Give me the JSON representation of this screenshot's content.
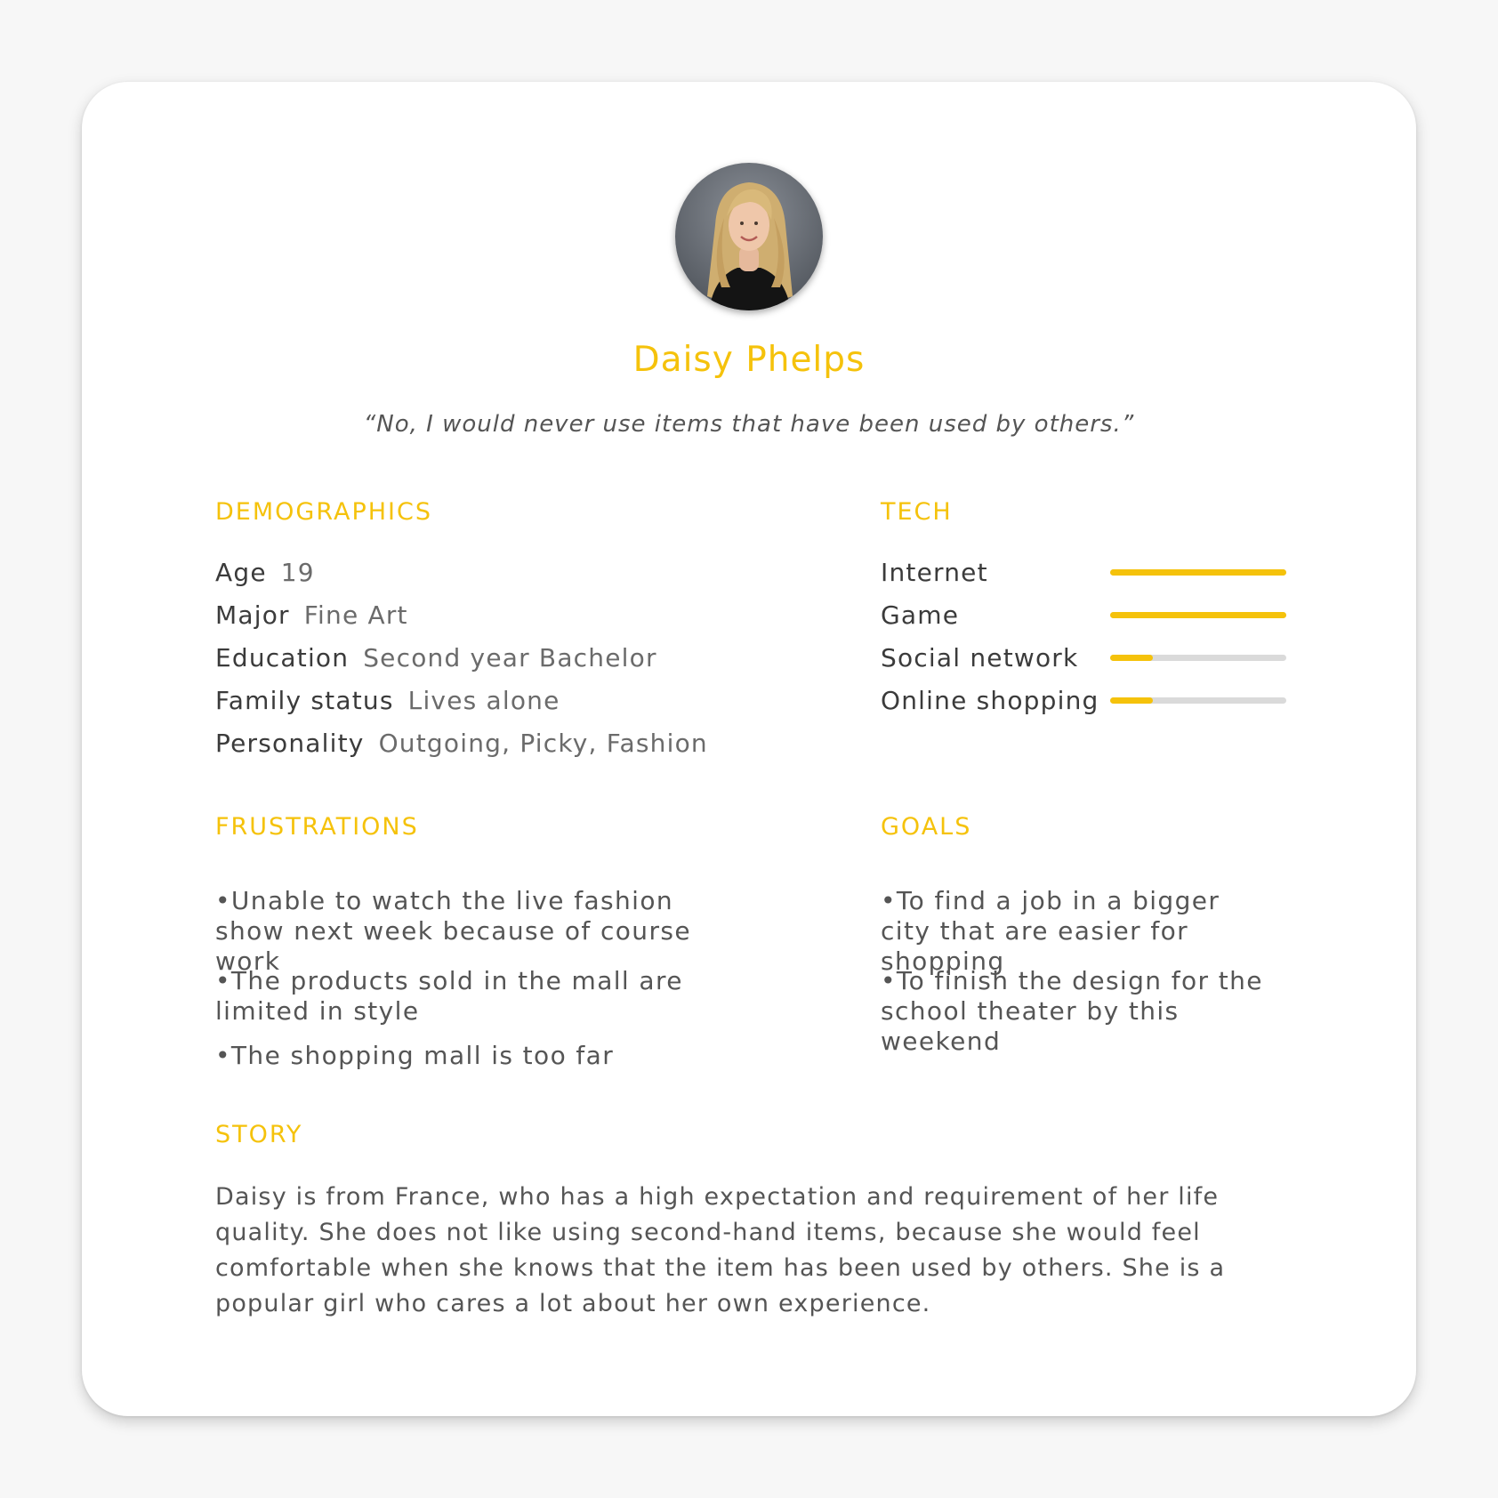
{
  "persona": {
    "name": "Daisy Phelps",
    "quote": "“No, I would never use items that have been used by others.”"
  },
  "demographics": {
    "title": "DEMOGRAPHICS",
    "rows": [
      {
        "key": "Age",
        "value": "19"
      },
      {
        "key": "Major",
        "value": "Fine Art"
      },
      {
        "key": "Education",
        "value": "Second year Bachelor"
      },
      {
        "key": "Family status",
        "value": "Lives alone"
      },
      {
        "key": "Personality",
        "value": "Outgoing, Picky, Fashion"
      }
    ]
  },
  "tech": {
    "title": "TECH",
    "accent_color": "#f5c20b",
    "track_color": "#dadada",
    "items": [
      {
        "label": "Internet",
        "level": 1.0
      },
      {
        "label": "Game",
        "level": 1.0
      },
      {
        "label": "Social network",
        "level": 0.24
      },
      {
        "label": "Online shopping",
        "level": 0.24
      }
    ]
  },
  "frustrations": {
    "title": "FRUSTRATIONS",
    "items": [
      "•Unable to watch the live fashion show next week because of course work",
      "•The products sold in the mall are limited in style",
      "•The shopping mall is too far"
    ]
  },
  "goals": {
    "title": "GOALS",
    "items": [
      "•To find a job in a bigger city that are easier for shopping",
      "•To finish the design for the school theater by this weekend"
    ]
  },
  "story": {
    "title": "STORY",
    "text": "Daisy is from France, who has a high expectation and requirement of her life quality. She does not like using second-hand items, because she would feel comfortable when she knows that the item has been used by others. She is a popular girl who cares a lot about her own experience."
  }
}
